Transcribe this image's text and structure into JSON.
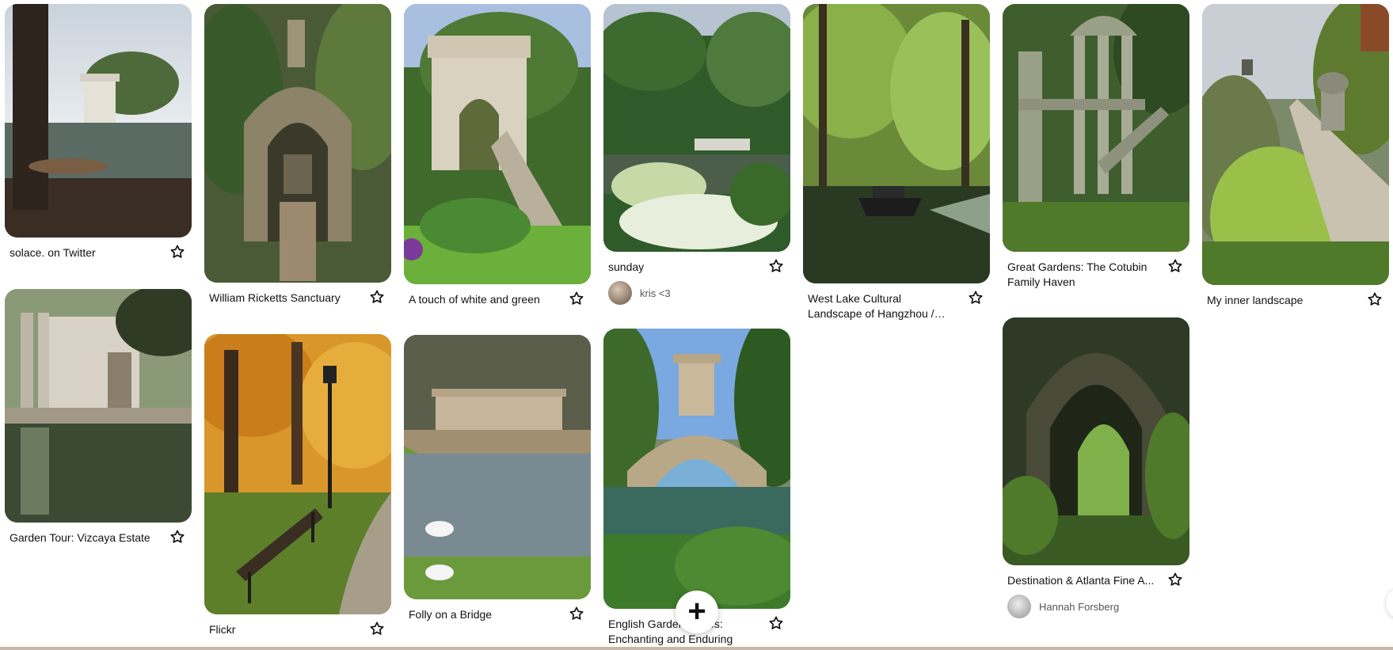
{
  "pins": [
    {
      "title": "solace. on Twitter",
      "image": "lake-temple-boats"
    },
    {
      "title": "Garden Tour: Vizcaya Estate",
      "image": "vizcaya-reflecting-pool"
    },
    {
      "title": "William Ricketts Sanctuary",
      "image": "stone-arch-sculpture"
    },
    {
      "title": "Flickr",
      "image": "autumn-park-bench"
    },
    {
      "title": "A touch of white and green",
      "image": "garden-gate-steps"
    },
    {
      "title": "Folly on a Bridge",
      "image": "palladian-bridge-swans"
    },
    {
      "title": "sunday",
      "image": "pond-hydrangeas",
      "author": "kris <3"
    },
    {
      "title": "English Garden Follies: Enchanting and Enduring",
      "image": "bridge-tower-folly"
    },
    {
      "title": "West Lake Cultural Landscape of Hangzhou / China...",
      "image": "willow-boat-river"
    },
    {
      "title": "Great Gardens: The Cotubin Family Haven",
      "image": "surreal-garden-towers"
    },
    {
      "title": "Destination & Atlanta Fine A...",
      "image": "gothic-stone-archway",
      "author": "Hannah Forsberg"
    },
    {
      "title": "My inner landscape",
      "image": "hillside-urn-stairs"
    }
  ],
  "actions": {
    "add_symbol": "+",
    "save_icon": "star-icon"
  },
  "colors": {
    "bottom_bar": "#c9b8a7",
    "text": "#111111"
  }
}
